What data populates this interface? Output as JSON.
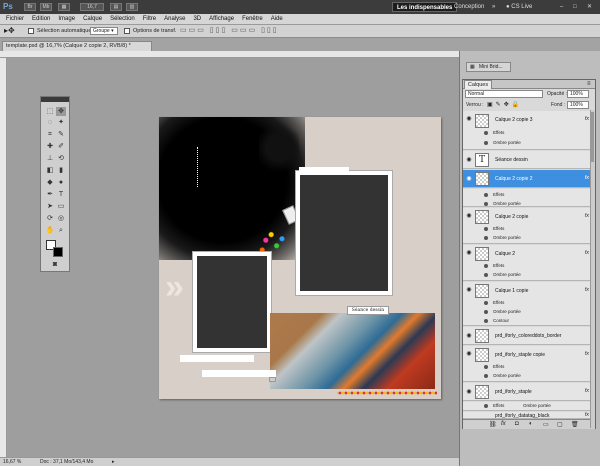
{
  "appbar": {
    "logo": "Ps",
    "zoom_field": "16,7",
    "workspaces": [
      "Les indispensables",
      "Conception"
    ],
    "more": "»",
    "cslive": "CS Live",
    "mini_buttons": [
      "Br",
      "Mb"
    ],
    "window_controls": [
      "–",
      "□",
      "✕"
    ]
  },
  "menubar": {
    "items": [
      "Fichier",
      "Edition",
      "Image",
      "Calque",
      "Sélection",
      "Filtre",
      "Analyse",
      "3D",
      "Affichage",
      "Fenêtre",
      "Aide"
    ]
  },
  "options_bar": {
    "auto_select_label": "Sélection automatique :",
    "auto_select_value": "Groupe",
    "transform_label": "Options de transf."
  },
  "document": {
    "tab_title": "template.psd @ 16,7% (Calque 2 copie 2, RVB/8) *",
    "caption": "Séance dessin"
  },
  "statusbar": {
    "zoom": "16,67 %",
    "doc": "Doc : 37,1 Mo/143,4 Mo"
  },
  "mini_panel": {
    "label": "Mini Brid..."
  },
  "layers_panel": {
    "tab": "Calques",
    "blend_mode": "Normal",
    "opacity_label": "Opacité :",
    "opacity_value": "100%",
    "lock_label": "Verrou :",
    "fill_label": "Fond :",
    "fill_value": "100%",
    "fx_symbol": "fx",
    "effects_label": "Effets",
    "layers": [
      {
        "name": "Calque 2 copie 3",
        "fx": true,
        "effects": [
          "Ombre portée"
        ]
      },
      {
        "name": "Séance dessin",
        "text": true
      },
      {
        "name": "Calque 2 copie 2",
        "fx": true,
        "selected": true,
        "effects": [
          "Ombre portée"
        ]
      },
      {
        "name": "Calque 2 copie",
        "fx": true,
        "effects": [
          "Ombre portée"
        ]
      },
      {
        "name": "Calque 2",
        "fx": true,
        "effects": [
          "Ombre portée"
        ]
      },
      {
        "name": "Calque 1 copie",
        "fx": true,
        "effects": [
          "Ombre portée",
          "Contour"
        ]
      },
      {
        "name": "prd_iforly_coloreddots_border"
      },
      {
        "name": "prd_iforly_staple copie",
        "fx": true,
        "effects": [
          "Ombre portée"
        ]
      },
      {
        "name": "prd_iforly_staple",
        "fx": true,
        "effects": [
          "Ombre portée"
        ]
      },
      {
        "name": "prd_iforly_datatag_black",
        "fx": true
      }
    ],
    "footer_icons": [
      "link-icon",
      "fx-icon",
      "mask-icon",
      "adjustment-icon",
      "folder-icon",
      "new-layer-icon",
      "trash-icon"
    ]
  },
  "toolbox": {
    "tools": [
      "move",
      "marquee",
      "lasso",
      "quick-select",
      "crop",
      "eyedropper",
      "healing",
      "brush",
      "stamp",
      "history-brush",
      "eraser",
      "gradient",
      "blur",
      "dodge",
      "pen",
      "type",
      "path-select",
      "shape",
      "3d-rotate",
      "3d-orbit",
      "hand",
      "zoom"
    ]
  },
  "colors": {
    "accent_selected": "#3f8fe0",
    "appbar": "#3c3c3c",
    "canvas_bg": "#9e9e9e"
  }
}
